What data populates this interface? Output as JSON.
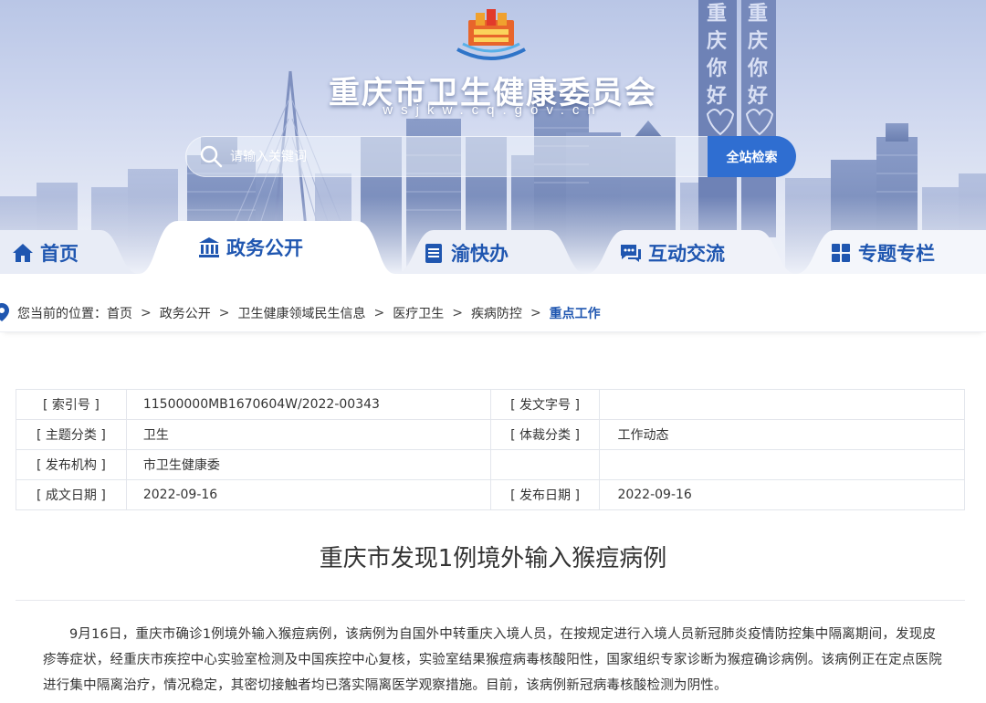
{
  "site": {
    "title": "重庆市卫生健康委员会",
    "domain": "wsjkw.cq.gov.cn"
  },
  "search": {
    "placeholder": "请输入关键词",
    "button_label": "全站检索"
  },
  "nav": {
    "items": [
      {
        "label": "首页",
        "icon": "home-icon"
      },
      {
        "label": "政务公开",
        "icon": "institution-icon",
        "active": true
      },
      {
        "label": "渝快办",
        "icon": "clipboard-icon"
      },
      {
        "label": "互动交流",
        "icon": "chat-icon"
      },
      {
        "label": "专题专栏",
        "icon": "grid-icon"
      }
    ]
  },
  "breadcrumb": {
    "label": "您当前的位置：",
    "items": [
      "首页",
      "政务公开",
      "卫生健康领域民生信息",
      "医疗卫生",
      "疾病防控"
    ],
    "separator": ">",
    "current": "重点工作"
  },
  "meta": {
    "rows": [
      {
        "k1": "[ 索引号 ]",
        "v1": "11500000MB1670604W/2022-00343",
        "k2": "[ 发文字号 ]",
        "v2": ""
      },
      {
        "k1": "[ 主题分类 ]",
        "v1": "卫生",
        "k2": "[ 体裁分类 ]",
        "v2": "工作动态"
      },
      {
        "k1": "[ 发布机构 ]",
        "v1": "市卫生健康委",
        "k2": "",
        "v2": ""
      },
      {
        "k1": "[ 成文日期 ]",
        "v1": "2022-09-16",
        "k2": "[ 发布日期 ]",
        "v2": "2022-09-16"
      }
    ]
  },
  "article": {
    "title": "重庆市发现1例境外输入猴痘病例",
    "body": "9月16日，重庆市确诊1例境外输入猴痘病例，该病例为自国外中转重庆入境人员，在按规定进行入境人员新冠肺炎疫情防控集中隔离期间，发现皮疹等症状，经重庆市疾控中心实验室检测及中国疾控中心复核，实验室结果猴痘病毒核酸阳性，国家组织专家诊断为猴痘确诊病例。该病例正在定点医院进行集中隔离治疗，情况稳定，其密切接触者均已落实隔离医学观察措施。目前，该病例新冠病毒核酸检测为阴性。"
  },
  "colors": {
    "brand_blue": "#1f56b0",
    "search_button": "#2f6ed1",
    "banner_sky": "#c5d0ec"
  }
}
